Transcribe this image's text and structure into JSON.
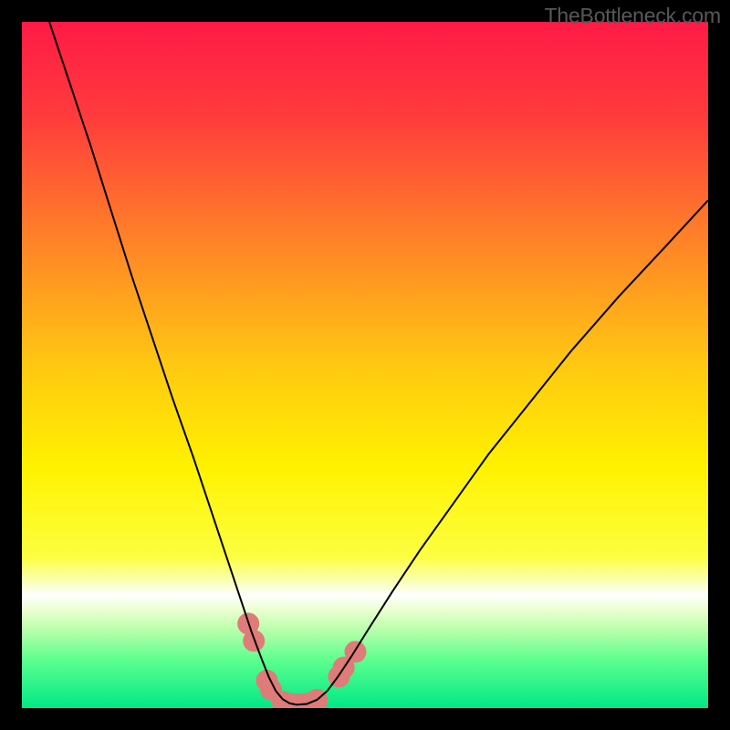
{
  "watermark": "TheBottleneck.com",
  "chart_data": {
    "type": "line",
    "title": "",
    "xlabel": "",
    "ylabel": "",
    "xlim": [
      0,
      100
    ],
    "ylim": [
      0,
      100
    ],
    "background_gradient": {
      "stops": [
        {
          "offset": 0.0,
          "color": "#ff1a46"
        },
        {
          "offset": 0.14,
          "color": "#ff3c3c"
        },
        {
          "offset": 0.3,
          "color": "#ff7b2a"
        },
        {
          "offset": 0.5,
          "color": "#ffc812"
        },
        {
          "offset": 0.65,
          "color": "#fff200"
        },
        {
          "offset": 0.78,
          "color": "#fcff41"
        },
        {
          "offset": 0.815,
          "color": "#fbffb4"
        },
        {
          "offset": 0.835,
          "color": "#ffffff"
        },
        {
          "offset": 0.855,
          "color": "#edffd2"
        },
        {
          "offset": 0.885,
          "color": "#baffac"
        },
        {
          "offset": 0.93,
          "color": "#5cff8e"
        },
        {
          "offset": 1.0,
          "color": "#00e886"
        }
      ]
    },
    "series": [
      {
        "name": "curve",
        "color": "#000000",
        "points": [
          {
            "x": 4.0,
            "y": 100.0
          },
          {
            "x": 7.0,
            "y": 91.0
          },
          {
            "x": 10.0,
            "y": 82.0
          },
          {
            "x": 13.0,
            "y": 72.5
          },
          {
            "x": 16.0,
            "y": 63.0
          },
          {
            "x": 19.0,
            "y": 54.0
          },
          {
            "x": 22.0,
            "y": 45.0
          },
          {
            "x": 25.0,
            "y": 36.5
          },
          {
            "x": 27.5,
            "y": 29.0
          },
          {
            "x": 30.0,
            "y": 21.5
          },
          {
            "x": 32.0,
            "y": 15.5
          },
          {
            "x": 33.5,
            "y": 11.0
          },
          {
            "x": 35.0,
            "y": 7.0
          },
          {
            "x": 36.0,
            "y": 4.5
          },
          {
            "x": 37.0,
            "y": 2.5
          },
          {
            "x": 38.0,
            "y": 1.3
          },
          {
            "x": 39.0,
            "y": 0.7
          },
          {
            "x": 40.0,
            "y": 0.5
          },
          {
            "x": 41.5,
            "y": 0.6
          },
          {
            "x": 43.0,
            "y": 1.2
          },
          {
            "x": 44.5,
            "y": 2.5
          },
          {
            "x": 46.0,
            "y": 4.5
          },
          {
            "x": 48.0,
            "y": 7.5
          },
          {
            "x": 50.5,
            "y": 11.5
          },
          {
            "x": 54.0,
            "y": 17.0
          },
          {
            "x": 58.0,
            "y": 23.0
          },
          {
            "x": 63.0,
            "y": 30.0
          },
          {
            "x": 68.0,
            "y": 37.0
          },
          {
            "x": 74.0,
            "y": 44.5
          },
          {
            "x": 80.0,
            "y": 52.0
          },
          {
            "x": 87.0,
            "y": 60.0
          },
          {
            "x": 94.0,
            "y": 67.5
          },
          {
            "x": 100.0,
            "y": 74.0
          }
        ]
      }
    ],
    "markers": {
      "color": "#df7b78",
      "radius_px": 12,
      "points": [
        {
          "x": 33.0,
          "y": 12.3
        },
        {
          "x": 33.8,
          "y": 9.8
        },
        {
          "x": 35.7,
          "y": 4.0
        },
        {
          "x": 36.3,
          "y": 2.7
        },
        {
          "x": 38.0,
          "y": 0.9
        },
        {
          "x": 39.3,
          "y": 0.6
        },
        {
          "x": 40.5,
          "y": 0.55
        },
        {
          "x": 41.8,
          "y": 0.7
        },
        {
          "x": 43.0,
          "y": 1.2
        },
        {
          "x": 46.2,
          "y": 4.6
        },
        {
          "x": 46.9,
          "y": 5.9
        },
        {
          "x": 48.6,
          "y": 8.2
        }
      ]
    }
  }
}
